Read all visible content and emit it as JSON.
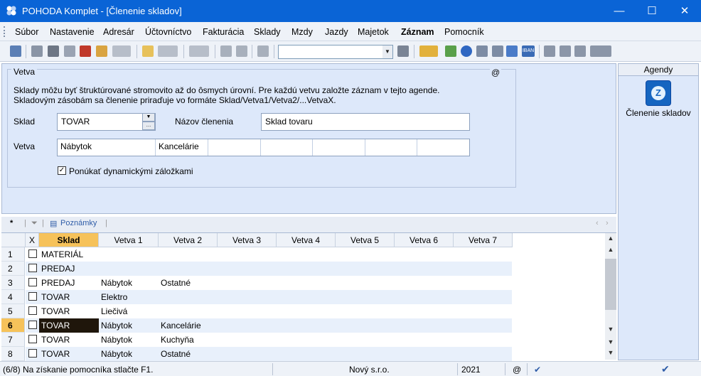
{
  "window": {
    "title": "POHODA Komplet - [Členenie skladov]",
    "controls": {
      "minimize": "—",
      "maximize": "☐",
      "close": "✕"
    }
  },
  "menu": [
    "Súbor",
    "Nastavenie",
    "Adresár",
    "Účtovníctvo",
    "Fakturácia",
    "Sklady",
    "Mzdy",
    "Jazdy",
    "Majetok",
    "Záznam",
    "Pomocník"
  ],
  "toolbar": {
    "combo_value": "",
    "icons": [
      "exit-icon",
      "new-record-icon",
      "print-icon",
      "print-preview-icon",
      "pdf-icon",
      "export-icon",
      "settings-icon",
      "new-icon",
      "edit-icon",
      "back-icon",
      "save-icon",
      "cancel-icon",
      "copy-icon",
      "filter-icon",
      "folder-icon",
      "money-icon",
      "euro-icon",
      "calculator-icon",
      "table-icon",
      "iban-icon",
      "message-icon",
      "list-icon",
      "mail-icon",
      "help-icon"
    ],
    "iban_label": "IBAN"
  },
  "form": {
    "group_label": "Vetva",
    "at_label": "@",
    "info_line1": "Sklady môžu byť štruktúrované stromovito až do ôsmych úrovní. Pre každú vetvu založte záznam v tejto agende.",
    "info_line2": "Skladovým zásobám sa členenie priraďuje vo formáte Sklad/Vetva1/Vetva2/...VetvaX.",
    "sklad_label": "Sklad",
    "sklad_value": "TOVAR",
    "nazov_label": "Názov členenia",
    "nazov_value": "Sklad tovaru",
    "vetva_label": "Vetva",
    "vetva_values": [
      "Nábytok",
      "Kancelárie",
      "",
      "",
      "",
      "",
      ""
    ],
    "checkbox_label": "Ponúkať dynamickými záložkami",
    "checkbox_checked": true
  },
  "agenda": {
    "header": "Agendy",
    "item_label": "Členenie skladov"
  },
  "tabs": {
    "star": "*",
    "notes": "Poznámky"
  },
  "grid": {
    "headers": [
      "X",
      "Sklad",
      "Vetva 1",
      "Vetva 2",
      "Vetva 3",
      "Vetva 4",
      "Vetva 5",
      "Vetva 6",
      "Vetva 7"
    ],
    "rows": [
      {
        "num": "1",
        "checked": false,
        "sklad": "MATERIÁL",
        "v1": "",
        "v2": ""
      },
      {
        "num": "2",
        "checked": false,
        "sklad": "PREDAJ",
        "v1": "",
        "v2": ""
      },
      {
        "num": "3",
        "checked": false,
        "sklad": "PREDAJ",
        "v1": "Nábytok",
        "v2": "Ostatné"
      },
      {
        "num": "4",
        "checked": false,
        "sklad": "TOVAR",
        "v1": "Elektro",
        "v2": ""
      },
      {
        "num": "5",
        "checked": false,
        "sklad": "TOVAR",
        "v1": "Liečivá",
        "v2": ""
      },
      {
        "num": "6",
        "checked": false,
        "sklad": "TOVAR",
        "v1": "Nábytok",
        "v2": "Kancelárie"
      },
      {
        "num": "7",
        "checked": false,
        "sklad": "TOVAR",
        "v1": "Nábytok",
        "v2": "Kuchyňa"
      },
      {
        "num": "8",
        "checked": false,
        "sklad": "TOVAR",
        "v1": "Nábytok",
        "v2": "Ostatné"
      }
    ],
    "current_row": "6"
  },
  "status": {
    "position": "(6/8) Na získanie pomocníka stlačte F1.",
    "company": "Nový s.r.o.",
    "year": "2021",
    "at": "@"
  }
}
